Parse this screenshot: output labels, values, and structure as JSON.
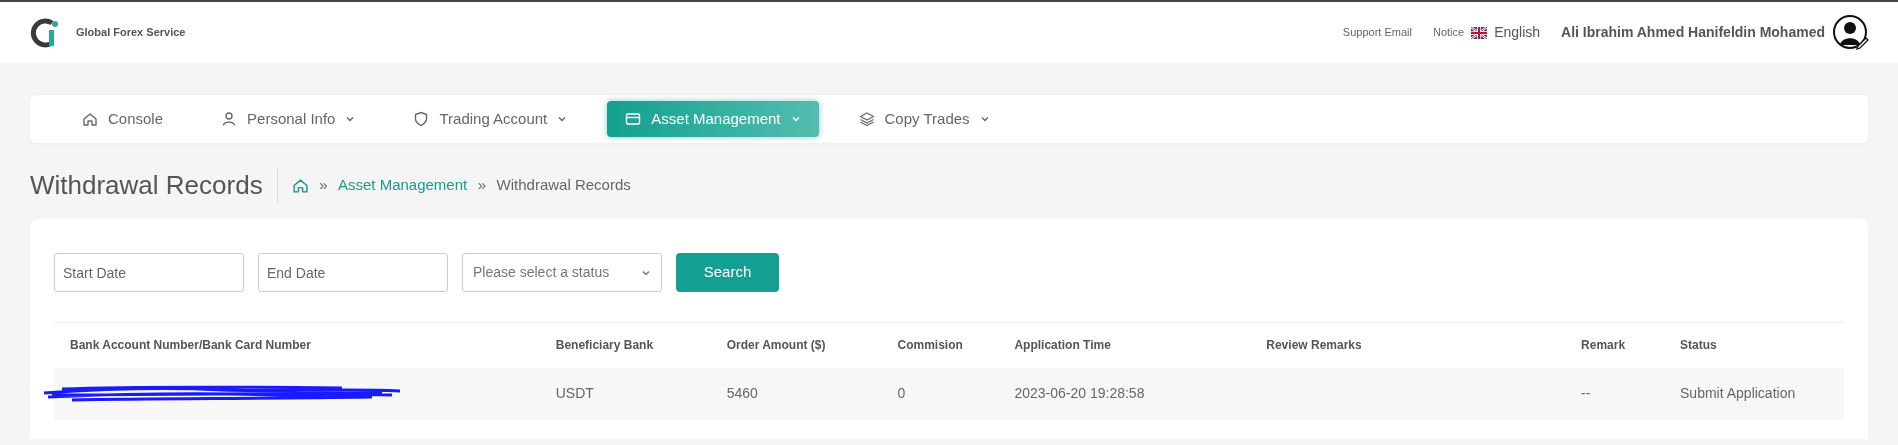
{
  "header": {
    "brand": "Global Forex Service",
    "links": [
      "Support Email",
      "Notice"
    ],
    "language": "English",
    "user_name": "Ali Ibrahim Ahmed Hanifeldin Mohamed"
  },
  "nav": [
    {
      "kind": "home",
      "label": "Console",
      "dropdown": false,
      "selected": false
    },
    {
      "kind": "person",
      "label": "Personal Info",
      "dropdown": true,
      "selected": false
    },
    {
      "kind": "shield",
      "label": "Trading Account",
      "dropdown": true,
      "selected": false
    },
    {
      "kind": "card",
      "label": "Asset Management",
      "dropdown": true,
      "selected": true
    },
    {
      "kind": "layers",
      "label": "Copy Trades",
      "dropdown": true,
      "selected": false
    }
  ],
  "page_title": "Withdrawal Records",
  "breadcrumb": [
    {
      "separator": "»",
      "label": "Asset Management",
      "kind": "link"
    },
    {
      "separator": "»",
      "label": "Withdrawal Records",
      "kind": "current"
    }
  ],
  "filters": {
    "start_date": {
      "placeholder": "Start Date"
    },
    "end_date": {
      "placeholder": "End Date"
    },
    "status": {
      "placeholder": "Please select a status"
    },
    "search_button": "Search"
  },
  "table": {
    "columns": [
      "Bank Account Number/Bank Card Number",
      "Beneficiary Bank",
      "Order Amount ($)",
      "Commision",
      "Application Time",
      "Review Remarks",
      "Remark",
      "Status"
    ],
    "rows": [
      {
        "redacted": true,
        "cells": [
          "",
          "USDT",
          "5460",
          "0",
          "2023-06-20 19:28:58",
          "",
          "--",
          "Submit Application"
        ]
      }
    ]
  }
}
